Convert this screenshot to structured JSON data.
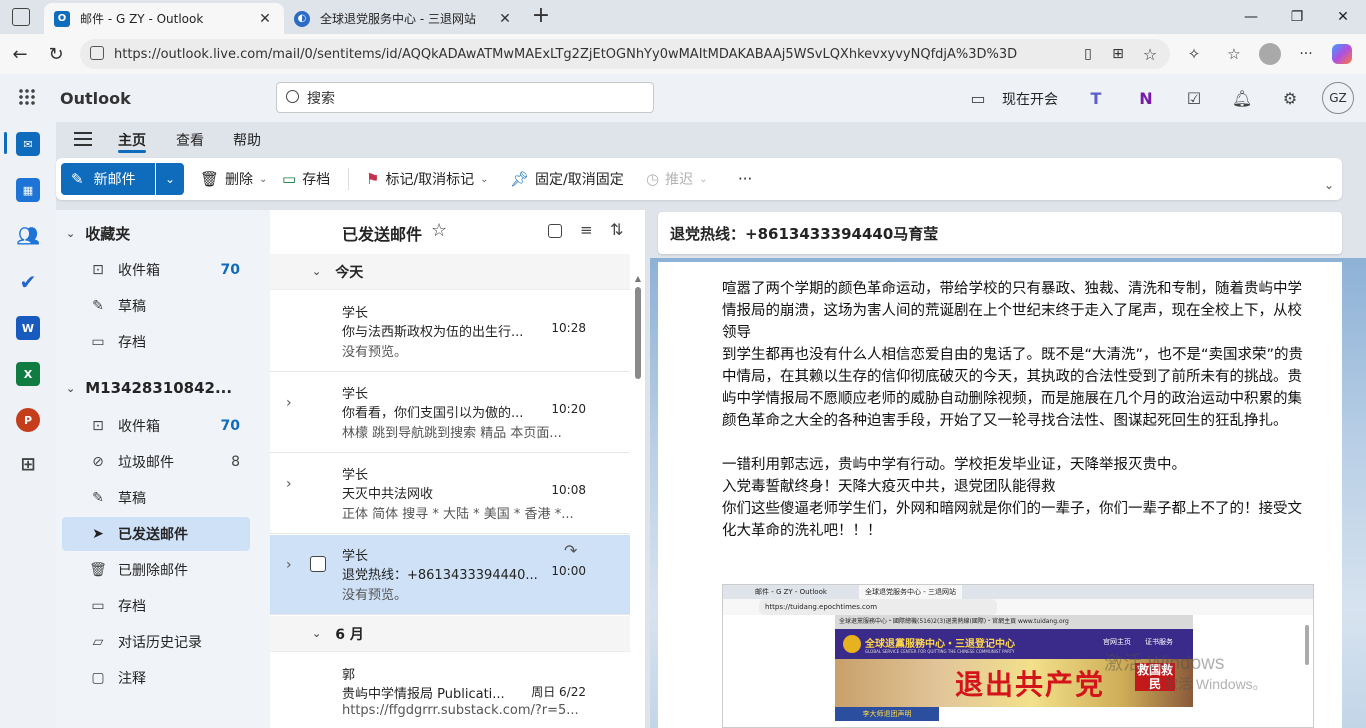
{
  "browser": {
    "tabs": [
      {
        "title": "邮件 - G ZY - Outlook",
        "active": true
      },
      {
        "title": "全球退党服务中心 - 三退网站",
        "active": false
      }
    ],
    "url": "https://outlook.live.com/mail/0/sentitems/id/AQQkADAwATMwMAExLTg2ZjEtOGNhYy0wMAItMDAKABAAj5WSvLQXhkevxyvyNQfdjA%3D%3D",
    "new_tab": "+"
  },
  "app": {
    "name": "Outlook",
    "search_placeholder": "搜索",
    "meet_now": "现在开会",
    "avatar": "GZ"
  },
  "ribbon": {
    "tabs": [
      "主页",
      "查看",
      "帮助"
    ],
    "new_mail": "新邮件",
    "delete": "删除",
    "archive": "存档",
    "flag": "标记/取消标记",
    "pin": "固定/取消固定",
    "snooze": "推迟",
    "more": "···"
  },
  "folders": {
    "favorites_title": "收藏夹",
    "favorites": [
      {
        "label": "收件箱",
        "count": "70",
        "icon": "inbox-icon"
      },
      {
        "label": "草稿",
        "count": "",
        "icon": "draft-icon"
      },
      {
        "label": "存档",
        "count": "",
        "icon": "archive-icon"
      }
    ],
    "account_title": "M13428310842...",
    "account": [
      {
        "label": "收件箱",
        "count": "70",
        "icon": "inbox-icon"
      },
      {
        "label": "垃圾邮件",
        "count": "8",
        "icon": "junk-icon"
      },
      {
        "label": "草稿",
        "count": "",
        "icon": "draft-icon"
      },
      {
        "label": "已发送邮件",
        "count": "",
        "icon": "send-icon",
        "selected": true
      },
      {
        "label": "已删除邮件",
        "count": "",
        "icon": "trash-icon"
      },
      {
        "label": "存档",
        "count": "",
        "icon": "archive-icon"
      },
      {
        "label": "对话历史记录",
        "count": "",
        "icon": "folder-icon"
      },
      {
        "label": "注释",
        "count": "",
        "icon": "note-icon"
      }
    ]
  },
  "list": {
    "title": "已发送邮件",
    "group_today": "今天",
    "group_june": "6 月",
    "messages": [
      {
        "from": "学长",
        "subject": "你与法西斯政权为伍的出生行...",
        "time": "10:28",
        "preview": "没有预览。",
        "thread": false,
        "selected": false
      },
      {
        "from": "学长",
        "subject": "你看看，你们支国引以为傲的...",
        "time": "10:20",
        "preview": "林檬 跳到导航跳到搜索 精品 本页面...",
        "thread": true,
        "selected": false
      },
      {
        "from": "学长",
        "subject": "天灭中共法网收",
        "time": "10:08",
        "preview": "正体 简体 搜寻 * 大陆 * 美国 * 香港 *...",
        "thread": true,
        "selected": false
      },
      {
        "from": "学长",
        "subject": "退党热线：+8613433394440...",
        "time": "10:00",
        "preview": "没有预览。",
        "thread": true,
        "selected": true
      },
      {
        "from": "郭",
        "subject": "贵屿中学情报局 Publicati...",
        "time": "周日 6/22",
        "preview": "https://ffgdgrrr.substack.com/?r=5...",
        "thread": false,
        "selected": false
      }
    ]
  },
  "reading": {
    "subject": "退党热线：+8613433394440马育莹",
    "paragraphs": [
      "喧嚣了两个学期的颜色革命运动，带给学校的只有暴政、独裁、清洗和专制，随着贵屿中学情报局的崩溃，这场为害人间的荒诞剧在上个世纪末终于走入了尾声，现在全校上下，从校领导",
      "到学生都再也没有什么人相信恋爱自由的鬼话了。既不是“大清洗”，也不是“卖国求荣”的贵中情局，在其赖以生存的信仰彻底破灭的今天，其执政的合法性受到了前所未有的挑战。贵",
      "屿中学情报局不愿顺应老师的威胁自动删除视频，而是施展在几个月的政治运动中积累的集颜色革命之大全的各种迫害手段，开始了又一轮寻找合法性、图谋起死回生的狂乱挣扎。",
      "",
      "一错利用郭志远，贵屿中学有行动。学校拒发毕业证，天降举报灭贵中。",
      "入党毒誓献终身！天降大疫灭中共，退党团队能得救",
      "你们这些傻逼老师学生们，外网和暗网就是你们的一辈子，你们一辈子都上不了的！接受文化大革命的洗礼吧！！！"
    ],
    "embedded": {
      "tab1": "邮件 - G ZY - Outlook",
      "tab2": "全球退党服务中心 - 三退网站",
      "url": "https://tuidang.epochtimes.com",
      "banner_title": "全球退黨服務中心・三退登记中心",
      "banner_sub": "GLOBAL SERVICE CENTER FOR QUITTING THE CHINESE COMMUNIST PARTY",
      "banner_big": "退出共产党",
      "banner_side": "救国救民",
      "nav1": "官网主页",
      "nav2": "证书服务",
      "sidebar": "李大师退团声明",
      "topline": "全球退黨服務中心・國際總機(516)2(3)退黨熱線(國際)・官網主頁 www.tuidang.org"
    },
    "watermark_line1": "激活 Windows",
    "watermark_line2": "激活 Windows。"
  }
}
